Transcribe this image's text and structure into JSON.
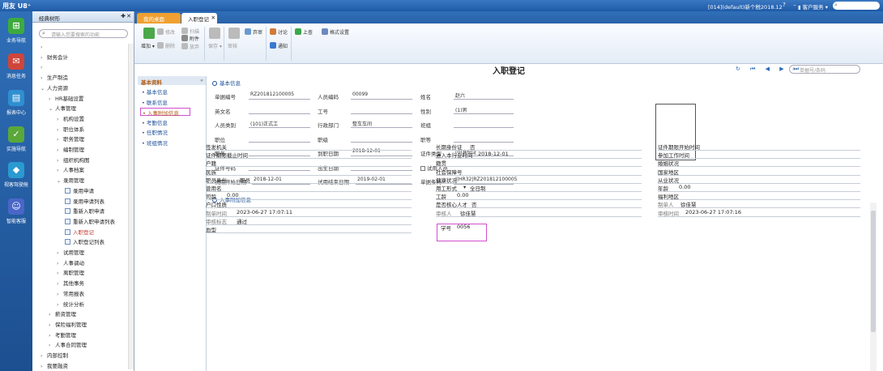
{
  "titlebar": {
    "brand": "用友 U8⁺",
    "account": "[014](default)新个税2018.12",
    "service": "客户服务",
    "search_placeholder": "单据条码搜索"
  },
  "leftnav": [
    {
      "label": "业务导航",
      "color": "#3daa3d",
      "glyph": "⊞"
    },
    {
      "label": "消息任务",
      "color": "#d0453a",
      "glyph": "✉"
    },
    {
      "label": "报表中心",
      "color": "#2f8fd0",
      "glyph": "▤"
    },
    {
      "label": "实施导航",
      "color": "#5aa83a",
      "glyph": "✓"
    },
    {
      "label": "视客驾驶舱",
      "color": "#2a9ad0",
      "glyph": "◆"
    },
    {
      "label": "智能客服",
      "color": "#4a66c8",
      "glyph": "☺"
    }
  ],
  "tree": {
    "title": "经典树形",
    "search_placeholder": "请输入您要搜索的功能",
    "nodes": [
      {
        "label": "",
        "arrow": "›",
        "depth": 0
      },
      {
        "label": "财务会计",
        "arrow": "›",
        "depth": 0
      },
      {
        "label": "",
        "arrow": "›",
        "depth": 0
      },
      {
        "label": "生产制造",
        "arrow": "›",
        "depth": 0
      },
      {
        "label": "人力资源",
        "arrow": "⌄",
        "depth": 0
      },
      {
        "label": "HR基础设置",
        "arrow": "›",
        "depth": 1
      },
      {
        "label": "人事管理",
        "arrow": "⌄",
        "depth": 1
      },
      {
        "label": "机构设置",
        "arrow": "›",
        "depth": 2
      },
      {
        "label": "职位体系",
        "arrow": "›",
        "depth": 2
      },
      {
        "label": "职务管理",
        "arrow": "›",
        "depth": 2
      },
      {
        "label": "编制管理",
        "arrow": "›",
        "depth": 2
      },
      {
        "label": "组织机构图",
        "arrow": "›",
        "depth": 2
      },
      {
        "label": "人事档案",
        "arrow": "›",
        "depth": 2
      },
      {
        "label": "录用管理",
        "arrow": "⌄",
        "depth": 2
      },
      {
        "label": "录用申请",
        "page": true,
        "depth": 3
      },
      {
        "label": "录用申请列表",
        "page": true,
        "depth": 3
      },
      {
        "label": "重新入职申请",
        "page": true,
        "depth": 3
      },
      {
        "label": "重新入职申请列表",
        "page": true,
        "depth": 3
      },
      {
        "label": "入职登记",
        "page": true,
        "depth": 3
      },
      {
        "label": "入职登记列表",
        "page": true,
        "depth": 3
      },
      {
        "label": "试用管理",
        "arrow": "›",
        "depth": 2
      },
      {
        "label": "人事调动",
        "arrow": "›",
        "depth": 2
      },
      {
        "label": "离职管理",
        "arrow": "›",
        "depth": 2
      },
      {
        "label": "其他事务",
        "arrow": "›",
        "depth": 2
      },
      {
        "label": "常用报表",
        "arrow": "›",
        "depth": 2
      },
      {
        "label": "统计分析",
        "arrow": "›",
        "depth": 2
      },
      {
        "label": "薪资管理",
        "arrow": "›",
        "depth": 1
      },
      {
        "label": "保险福利管理",
        "arrow": "›",
        "depth": 1
      },
      {
        "label": "考勤管理",
        "arrow": "›",
        "depth": 1
      },
      {
        "label": "人事合同管理",
        "arrow": "›",
        "depth": 1
      },
      {
        "label": "内部控制",
        "arrow": "›",
        "depth": 0
      },
      {
        "label": "我要融资",
        "arrow": "›",
        "depth": 0
      }
    ]
  },
  "tabs": [
    {
      "label": "我的桌面"
    },
    {
      "label": "入职登记"
    }
  ],
  "toolbar": {
    "add": "增加",
    "modify": "修改",
    "delete": "删除",
    "scan": "扫描",
    "attach": "附件",
    "discard": "放弃",
    "save": "保存",
    "audit": "审核",
    "approve": "弃审",
    "discuss": "讨论",
    "notify": "通知",
    "report": "上查",
    "format": "格式设置"
  },
  "page": {
    "title": "入职登记",
    "doc_search_placeholder": "单据号/条码",
    "pager": "↻ ⏮ ◀ ▶ ⏭"
  },
  "side": {
    "header": "基本资料",
    "items": [
      "基本信息",
      "联系信息",
      "入事附加信息",
      "考勤信息",
      "任职情况",
      "班组情况"
    ]
  },
  "basic": {
    "section": "基本信息",
    "fields": [
      {
        "label": "单据编号",
        "value": "RZ201812100005"
      },
      {
        "label": "人员编码",
        "value": "00099"
      },
      {
        "label": "姓名",
        "value": "赵六"
      },
      {
        "label": "英文名",
        "value": ""
      },
      {
        "label": "工号",
        "value": ""
      },
      {
        "label": "性别",
        "value": "(1)男"
      },
      {
        "label": "人员类别",
        "value": "(101)正式工"
      },
      {
        "label": "行政部门",
        "value": "整车车间"
      },
      {
        "label": "班组",
        "value": ""
      },
      {
        "label": "职位",
        "value": ""
      },
      {
        "label": "职级",
        "value": ""
      },
      {
        "label": "职等",
        "value": ""
      },
      {
        "label": "职务",
        "value": ""
      },
      {
        "label": "到职日期",
        "value": "2018-12-01"
      },
      {
        "label": "证件类型",
        "value": "(0)身份证"
      },
      {
        "label": "证件号码",
        "value": ""
      },
      {
        "label": "出生日期",
        "value": ""
      },
      {
        "label": "试用人员",
        "value": ""
      },
      {
        "label": "试用开始日期",
        "value": "2018-12-01"
      },
      {
        "label": "试用结束日期",
        "value": "2019-02-01"
      },
      {
        "label": "单据条码",
        "value": "||HR32|RZ201812100005"
      }
    ]
  },
  "extra": {
    "section": "入事附加信息",
    "col1": [
      {
        "label": "签发机关",
        "value": ""
      },
      {
        "label": "证件期限截止时间",
        "value": ""
      },
      {
        "label": "户籍",
        "value": ""
      },
      {
        "label": "民族",
        "value": ""
      },
      {
        "label": "职员身份",
        "value": "职员"
      },
      {
        "label": "曾用名",
        "value": ""
      },
      {
        "label": "司龄",
        "value": "0.00"
      },
      {
        "label": "户口性质",
        "value": ""
      },
      {
        "label": "制单时间",
        "value": "2023-06-27 17:07:11"
      },
      {
        "label": "审核标志",
        "value": "通过"
      },
      {
        "label": "血型",
        "value": ""
      }
    ],
    "col2": [
      {
        "label": "长期身份证",
        "value": "否"
      },
      {
        "label": "进入本行业时间",
        "value": "2018-12-01"
      },
      {
        "label": "籍贯",
        "value": ""
      },
      {
        "label": "社会保障号",
        "value": ""
      },
      {
        "label": "健康状况",
        "value": ""
      },
      {
        "label": "用工形式",
        "value": "全日制"
      },
      {
        "label": "工龄",
        "value": "0.00"
      },
      {
        "label": "是否核心人才",
        "value": "否"
      },
      {
        "label": "审核人",
        "value": "徐佳慧"
      },
      {
        "label": "学号",
        "value": "0056"
      }
    ],
    "col3": [
      {
        "label": "证件期限开始时间",
        "value": ""
      },
      {
        "label": "参加工作时间",
        "value": ""
      },
      {
        "label": "婚姻状况",
        "value": ""
      },
      {
        "label": "国家地区",
        "value": ""
      },
      {
        "label": "从业状况",
        "value": ""
      },
      {
        "label": "年龄",
        "value": "0.00"
      },
      {
        "label": "福利地区",
        "value": ""
      },
      {
        "label": "制单人",
        "value": "徐佳慧"
      },
      {
        "label": "审核时间",
        "value": "2023-06-27 17:07:16"
      }
    ]
  }
}
